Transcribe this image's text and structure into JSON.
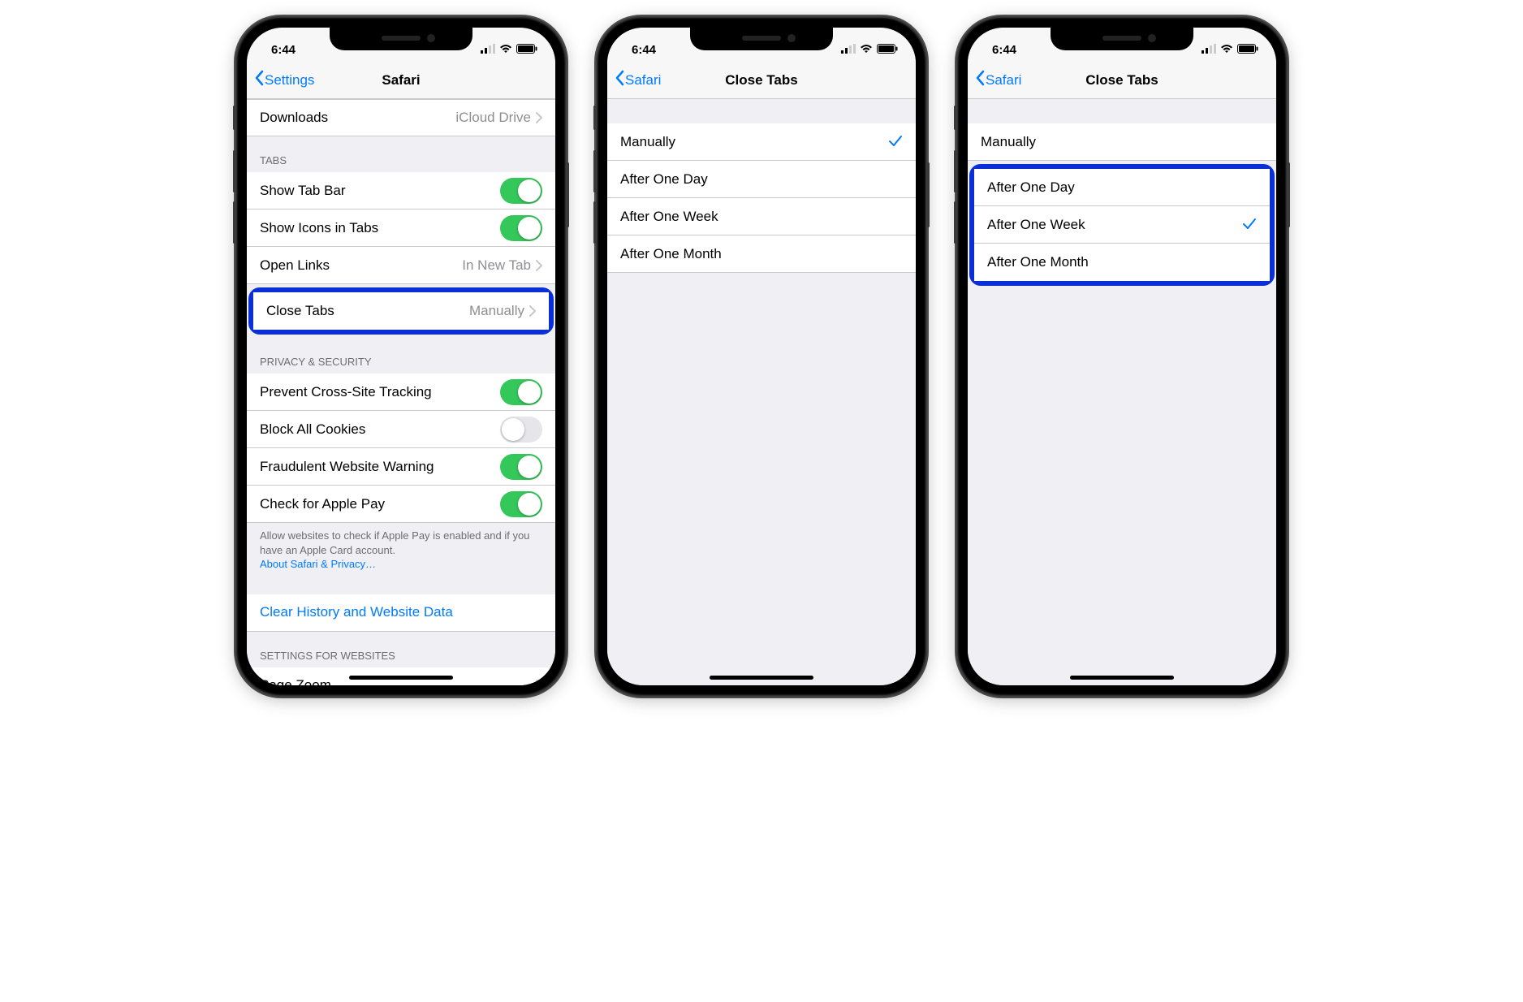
{
  "status": {
    "time": "6:44"
  },
  "colors": {
    "highlight": "#0a2fd6",
    "tint": "#007aff",
    "toggle_on": "#34c759"
  },
  "phone1": {
    "nav": {
      "back": "Settings",
      "title": "Safari"
    },
    "downloads": {
      "label": "Downloads",
      "value": "iCloud Drive"
    },
    "tabs_header": "TABS",
    "tabs": {
      "show_tab_bar": {
        "label": "Show Tab Bar",
        "on": true
      },
      "show_icons": {
        "label": "Show Icons in Tabs",
        "on": true
      },
      "open_links": {
        "label": "Open Links",
        "value": "In New Tab"
      },
      "close_tabs": {
        "label": "Close Tabs",
        "value": "Manually"
      }
    },
    "privacy_header": "PRIVACY & SECURITY",
    "privacy": {
      "prevent": {
        "label": "Prevent Cross-Site Tracking",
        "on": true
      },
      "block": {
        "label": "Block All Cookies",
        "on": false
      },
      "fraud": {
        "label": "Fraudulent Website Warning",
        "on": true
      },
      "applepay": {
        "label": "Check for Apple Pay",
        "on": true
      }
    },
    "privacy_footer_text": "Allow websites to check if Apple Pay is enabled and if you have an Apple Card account.",
    "privacy_footer_link": "About Safari & Privacy…",
    "clear_label": "Clear History and Website Data",
    "websites_header": "SETTINGS FOR WEBSITES",
    "page_zoom": "Page Zoom"
  },
  "phone2": {
    "nav": {
      "back": "Safari",
      "title": "Close Tabs"
    },
    "options": [
      "Manually",
      "After One Day",
      "After One Week",
      "After One Month"
    ],
    "selected_index": 0
  },
  "phone3": {
    "nav": {
      "back": "Safari",
      "title": "Close Tabs"
    },
    "options": [
      "Manually",
      "After One Day",
      "After One Week",
      "After One Month"
    ],
    "selected_index": 2
  }
}
